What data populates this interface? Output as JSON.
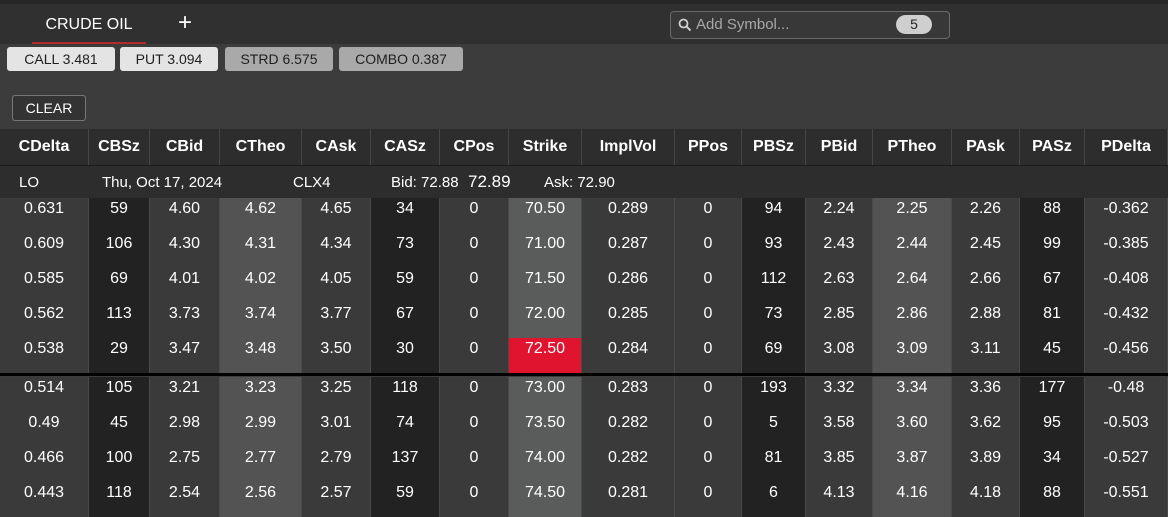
{
  "tabs": {
    "active": "CRUDE OIL",
    "add": "+"
  },
  "search": {
    "placeholder": "Add Symbol...",
    "count": "5"
  },
  "strategy_buttons": [
    {
      "label": "CALL 3.481"
    },
    {
      "label": "PUT 3.094"
    },
    {
      "label": "STRD 6.575"
    },
    {
      "label": "COMBO 0.387"
    }
  ],
  "clear_label": "CLEAR",
  "columns": [
    "CDelta",
    "CBSz",
    "CBid",
    "CTheo",
    "CAsk",
    "CASz",
    "CPos",
    "Strike",
    "ImplVol",
    "PPos",
    "PBSz",
    "PBid",
    "PTheo",
    "PAsk",
    "PASz",
    "PDelta"
  ],
  "info": {
    "root": "LO",
    "date": "Thu, Oct 17, 2024",
    "contract": "CLX4",
    "bid": "Bid: 72.88",
    "last": "72.89",
    "ask": "Ask: 72.90"
  },
  "atm_strike": "72.50",
  "colors": {
    "atm_highlight": "#e0142e",
    "strike_bg": "#5a5c5c"
  },
  "rows": [
    [
      "0.631",
      "59",
      "4.60",
      "4.62",
      "4.65",
      "34",
      "0",
      "70.50",
      "0.289",
      "0",
      "94",
      "2.24",
      "2.25",
      "2.26",
      "88",
      "-0.362"
    ],
    [
      "0.609",
      "106",
      "4.30",
      "4.31",
      "4.34",
      "73",
      "0",
      "71.00",
      "0.287",
      "0",
      "93",
      "2.43",
      "2.44",
      "2.45",
      "99",
      "-0.385"
    ],
    [
      "0.585",
      "69",
      "4.01",
      "4.02",
      "4.05",
      "59",
      "0",
      "71.50",
      "0.286",
      "0",
      "112",
      "2.63",
      "2.64",
      "2.66",
      "67",
      "-0.408"
    ],
    [
      "0.562",
      "113",
      "3.73",
      "3.74",
      "3.77",
      "67",
      "0",
      "72.00",
      "0.285",
      "0",
      "73",
      "2.85",
      "2.86",
      "2.88",
      "81",
      "-0.432"
    ],
    [
      "0.538",
      "29",
      "3.47",
      "3.48",
      "3.50",
      "30",
      "0",
      "72.50",
      "0.284",
      "0",
      "69",
      "3.08",
      "3.09",
      "3.11",
      "45",
      "-0.456"
    ],
    [
      "0.514",
      "105",
      "3.21",
      "3.23",
      "3.25",
      "118",
      "0",
      "73.00",
      "0.283",
      "0",
      "193",
      "3.32",
      "3.34",
      "3.36",
      "177",
      "-0.48"
    ],
    [
      "0.49",
      "45",
      "2.98",
      "2.99",
      "3.01",
      "74",
      "0",
      "73.50",
      "0.282",
      "0",
      "5",
      "3.58",
      "3.60",
      "3.62",
      "95",
      "-0.503"
    ],
    [
      "0.466",
      "100",
      "2.75",
      "2.77",
      "2.79",
      "137",
      "0",
      "74.00",
      "0.282",
      "0",
      "81",
      "3.85",
      "3.87",
      "3.89",
      "34",
      "-0.527"
    ],
    [
      "0.443",
      "118",
      "2.54",
      "2.56",
      "2.57",
      "59",
      "0",
      "74.50",
      "0.281",
      "0",
      "6",
      "4.13",
      "4.16",
      "4.18",
      "88",
      "-0.551"
    ]
  ]
}
